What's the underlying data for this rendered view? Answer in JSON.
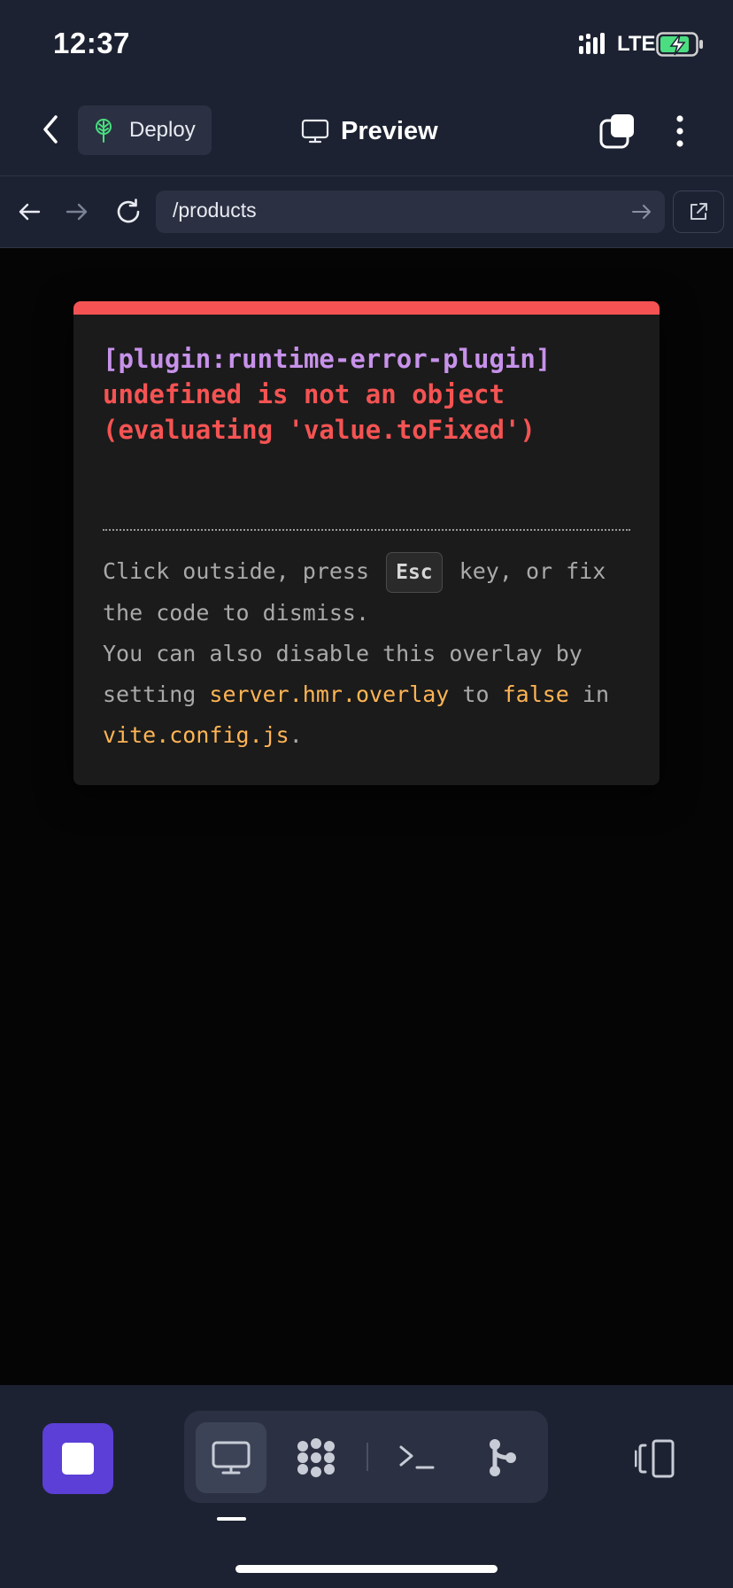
{
  "status_bar": {
    "time": "12:37",
    "network": "LTE"
  },
  "header": {
    "deploy_label": "Deploy",
    "title": "Preview"
  },
  "url_bar": {
    "path": "/products"
  },
  "error_overlay": {
    "plugin": "[plugin:runtime-error-plugin]",
    "message_line1": "undefined is not an object",
    "message_line2": "(evaluating 'value.toFixed')",
    "tip_part1": "Click outside, press",
    "tip_key": "Esc",
    "tip_part2": "key, or fix the code to dismiss.",
    "tip_part3": "You can also disable this overlay by setting",
    "tip_code1": "server.hmr.overlay",
    "tip_part4": "to",
    "tip_code2": "false",
    "tip_part5": "in",
    "tip_code3": "vite.config.js",
    "tip_part6": "."
  },
  "colors": {
    "accent": "#5b3fd6",
    "error": "#f55353",
    "plugin": "#c792ea",
    "code": "#ffb454",
    "deploy_icon": "#4ade80",
    "battery": "#4ade80"
  }
}
